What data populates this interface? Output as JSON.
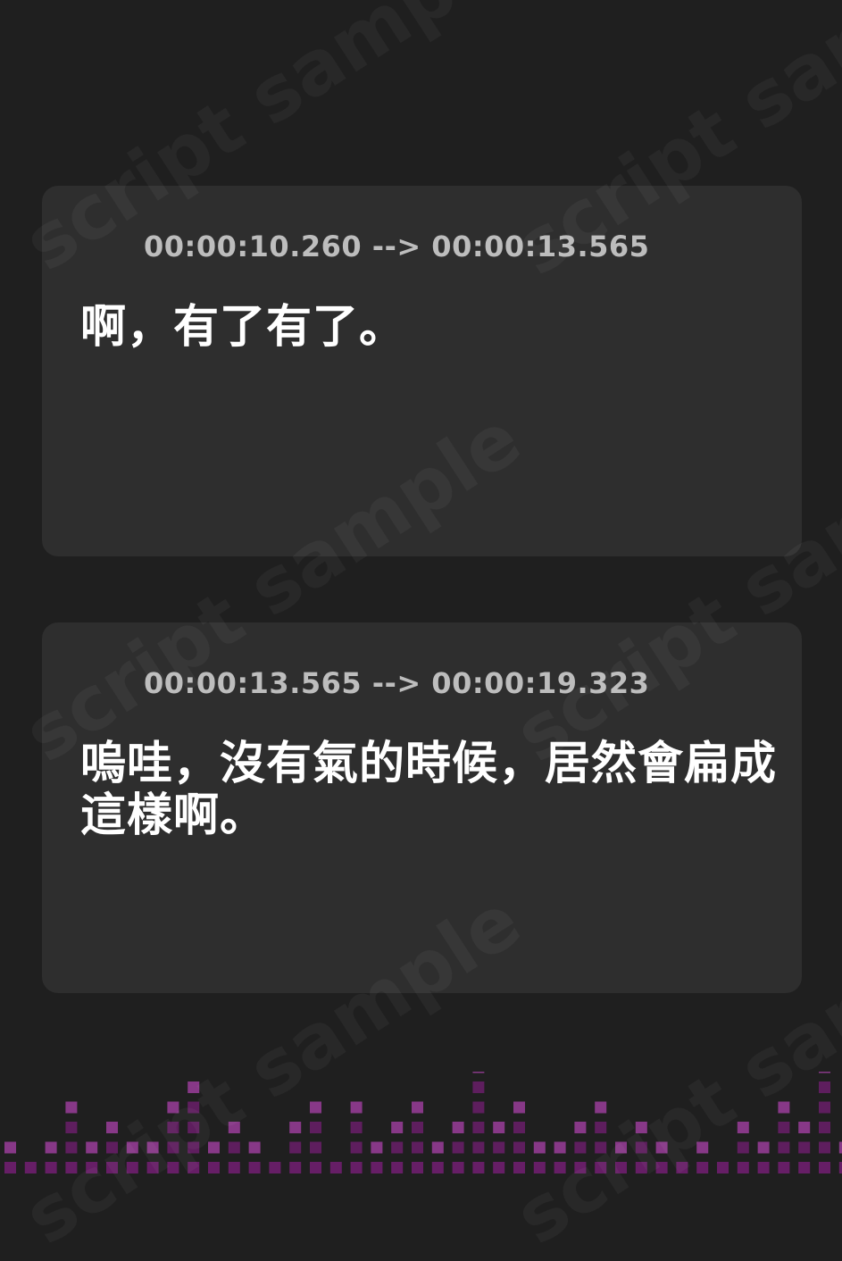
{
  "watermark": {
    "text": "script sample"
  },
  "subtitles": [
    {
      "timestamp": "00:00:10.260 --> 00:00:13.565",
      "text": "啊，有了有了。"
    },
    {
      "timestamp": "00:00:13.565 --> 00:00:19.323",
      "text": "嗚哇，沒有氣的時候，居然會扁成這樣啊。"
    }
  ],
  "icons": {
    "card_icon": "sound-wave-icon"
  },
  "colors": {
    "background": "#1f1f1f",
    "card": "#2e2e2e",
    "accent": "#d04fd6",
    "equalizer_light": "#9a3d9a",
    "equalizer_dark": "#6a1f6a"
  }
}
